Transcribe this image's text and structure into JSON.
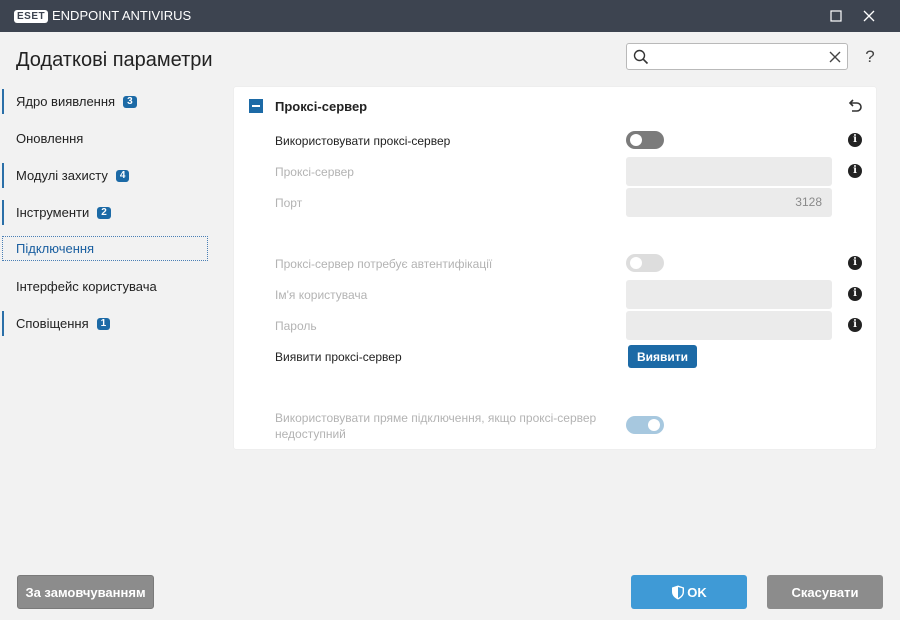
{
  "window": {
    "logo_text": "ESET",
    "app_name": "ENDPOINT ANTIVIRUS",
    "icons": {
      "maximize": "maximize-icon",
      "close": "close-icon"
    }
  },
  "header": {
    "title": "Додаткові параметри",
    "search": {
      "value": "",
      "placeholder": ""
    },
    "help_label": "?"
  },
  "sidebar": {
    "items": [
      {
        "label": "Ядро виявлення",
        "badge": "3"
      },
      {
        "label": "Оновлення",
        "badge": ""
      },
      {
        "label": "Модулі захисту",
        "badge": "4"
      },
      {
        "label": "Інструменти",
        "badge": "2"
      },
      {
        "label": "Підключення",
        "badge": "",
        "selected": true
      },
      {
        "label": "Інтерфейс користувача",
        "badge": ""
      },
      {
        "label": "Сповіщення",
        "badge": "1"
      }
    ]
  },
  "section": {
    "title": "Проксі-сервер",
    "rows": {
      "use_proxy": {
        "label": "Використовувати проксі-сервер",
        "state": "off"
      },
      "proxy_server": {
        "label": "Проксі-сервер",
        "value": ""
      },
      "port": {
        "label": "Порт",
        "value": "3128"
      },
      "requires_auth": {
        "label": "Проксі-сервер потребує автентифікації",
        "state": "off",
        "disabled": true
      },
      "username": {
        "label": "Ім'я користувача",
        "value": ""
      },
      "password": {
        "label": "Пароль",
        "value": ""
      },
      "detect": {
        "label": "Виявити проксі-сервер",
        "button": "Виявити"
      },
      "direct": {
        "label_line1": "Використовувати пряме підключення, якщо проксі-сервер",
        "label_line2": "недоступний",
        "state": "on",
        "disabled": true
      }
    },
    "info_glyph": "i"
  },
  "footer": {
    "default_label": "За замовчуванням",
    "ok_label": "OK",
    "cancel_label": "Скасувати"
  },
  "colors": {
    "titlebar": "#3d4450",
    "accent": "#1c6aa6",
    "ok_button": "#3f9ad6",
    "gray_button": "#8c8c8c"
  }
}
